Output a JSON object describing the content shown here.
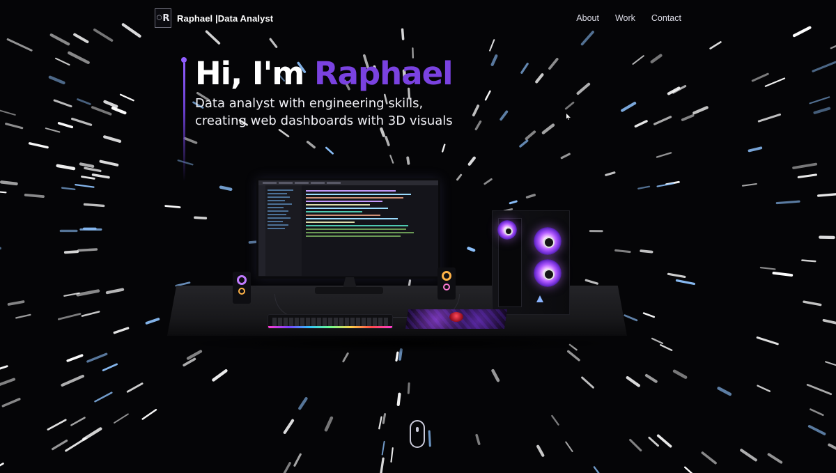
{
  "navbar": {
    "logo_text": "R",
    "brand_name": "Raphael",
    "brand_role": "|Data Analyst",
    "links": [
      "About",
      "Work",
      "Contact"
    ]
  },
  "hero": {
    "greeting": "Hi, I'm ",
    "name": "Raphael",
    "subtitle_line1": "Data analyst with engineering skills,",
    "subtitle_line2": "creating web dashboards with 3D visuals"
  },
  "colors": {
    "background": "#050507",
    "accent": "#7a42e0",
    "accent_light": "#915eff",
    "text": "#ffffff",
    "scroll_indicator": "#c9c9d8"
  },
  "icons": {
    "logo": "hexagon-r-logo-icon",
    "scroll": "mouse-scroll-icon",
    "cursor": "pointer-cursor-icon"
  }
}
